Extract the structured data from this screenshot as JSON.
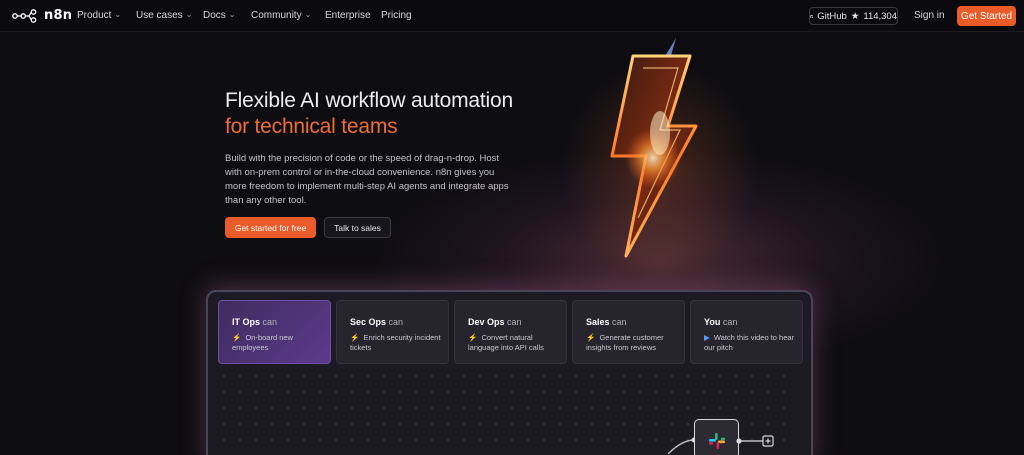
{
  "nav": {
    "logo_text": "n8n",
    "menu": [
      {
        "label": "Product",
        "has_dropdown": true
      },
      {
        "label": "Use cases",
        "has_dropdown": true
      },
      {
        "label": "Docs",
        "has_dropdown": true
      },
      {
        "label": "Community",
        "has_dropdown": true
      },
      {
        "label": "Enterprise",
        "has_dropdown": false
      },
      {
        "label": "Pricing",
        "has_dropdown": false
      }
    ],
    "github_label": "GitHub",
    "github_star": "★",
    "github_stars": "114,304",
    "sign_in": "Sign in",
    "cta": "Get Started"
  },
  "hero": {
    "title_line1": "Flexible AI workflow automation",
    "title_line2": "for technical teams",
    "description": "Build with the precision of code or the speed of drag-n-drop. Host with on-prem control or in-the-cloud convenience. n8n gives you more freedom to implement multi-step AI agents and integrate apps than any other tool.",
    "primary_button": "Get started for free",
    "secondary_button": "Talk to sales"
  },
  "tabs": [
    {
      "role": "IT Ops",
      "suffix": "can",
      "icon": "⚡",
      "text": "On-board new employees",
      "active": true
    },
    {
      "role": "Sec Ops",
      "suffix": "can",
      "icon": "⚡",
      "text": "Enrich security incident tickets",
      "active": false
    },
    {
      "role": "Dev Ops",
      "suffix": "can",
      "icon": "⚡",
      "text": "Convert natural language into API calls",
      "active": false
    },
    {
      "role": "Sales",
      "suffix": "can",
      "icon": "⚡",
      "text": "Generate customer insights from reviews",
      "active": false
    },
    {
      "role": "You",
      "suffix": "can",
      "icon": "▶",
      "text": "Watch this video to hear our pitch",
      "active": false
    }
  ],
  "colors": {
    "accent": "#ea5b2a",
    "highlight_text": "#ee6d35",
    "active_tab": "#5c3a8c",
    "background": "#0e0d12"
  },
  "icons": {
    "logo": "n8n-logo-icon",
    "github": "github-icon",
    "bolt": "lightning-bolt-illustration",
    "node": "slack-icon"
  }
}
